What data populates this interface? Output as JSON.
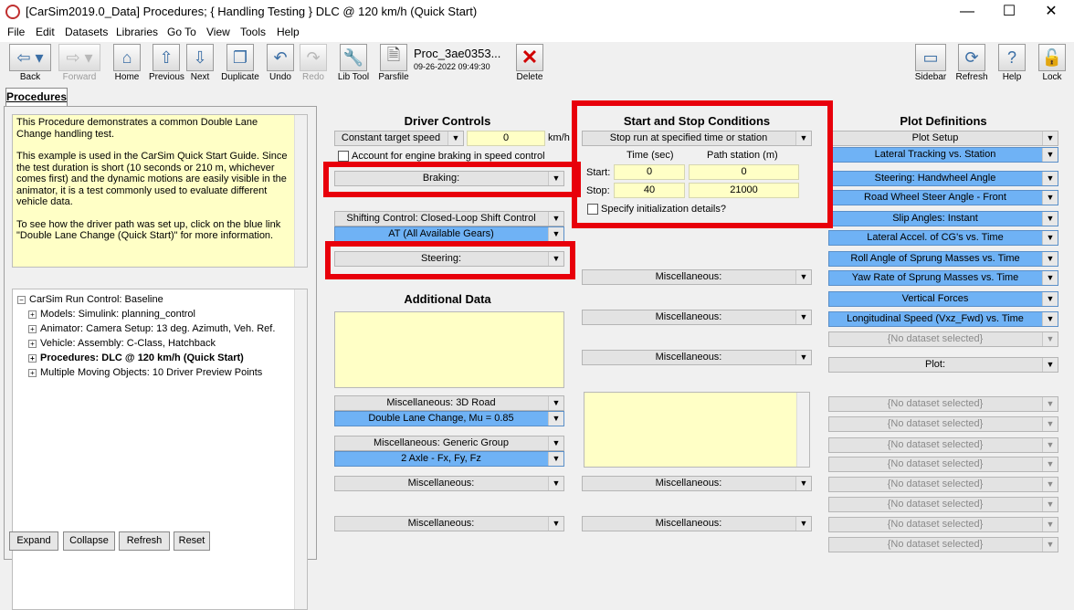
{
  "window": {
    "title": "[CarSim2019.0_Data] Procedures; { Handling Testing } DLC @ 120 km/h (Quick Start)",
    "minimize": "—",
    "maximize": "☐",
    "close": "✕"
  },
  "menu": [
    "File",
    "Edit",
    "Datasets",
    "Libraries",
    "Go To",
    "View",
    "Tools",
    "Help"
  ],
  "toolbar": {
    "back": "Back",
    "forward": "Forward",
    "home": "Home",
    "previous": "Previous",
    "next": "Next",
    "duplicate": "Duplicate",
    "undo": "Undo",
    "redo": "Redo",
    "lib_tool": "Lib Tool",
    "parsfile": "Parsfile",
    "dataset_name": "Proc_3ae0353...",
    "dataset_date": "09-26-2022 09:49:30",
    "delete": "Delete",
    "sidebar": "Sidebar",
    "refresh": "Refresh",
    "help": "Help",
    "lock": "Lock"
  },
  "tab": "Procedures",
  "notes": [
    "This Procedure demonstrates a common Double Lane Change handling test.",
    "This example is used in the CarSim Quick Start Guide. Since the test duration is short (10 seconds or 210 m, whichever comes first) and the dynamic motions are easily visible in the animator, it is a test commonly used to evaluate different vehicle data.",
    "To see how the driver path was set up, click on the blue link \"Double Lane Change (Quick Start)\" for more information."
  ],
  "tree": [
    "CarSim Run Control: Baseline",
    "Models: Simulink: planning_control",
    "Animator: Camera Setup: 13 deg. Azimuth, Veh. Ref.",
    "Vehicle: Assembly: C-Class, Hatchback",
    "Procedures: DLC @ 120 km/h (Quick Start)",
    "Multiple Moving Objects: 10 Driver Preview Points"
  ],
  "buttons": {
    "expand": "Expand",
    "collapse": "Collapse",
    "refresh": "Refresh",
    "reset": "Reset"
  },
  "driver": {
    "title": "Driver Controls",
    "speed_mode": "Constant target speed",
    "speed_value": "0",
    "speed_unit": "km/h",
    "engine_braking": "Account for engine braking in speed control",
    "braking": "Braking:",
    "shifting": "Shifting Control: Closed-Loop Shift Control",
    "gears": "AT (All Available Gears)",
    "steering": "Steering:"
  },
  "additional": {
    "title": "Additional Data",
    "misc_3d": "Miscellaneous: 3D Road",
    "road": "Double Lane Change, Mu = 0.85",
    "misc_generic": "Miscellaneous: Generic Group",
    "generic": "2 Axle - Fx, Fy, Fz",
    "misc1": "Miscellaneous:",
    "misc2": "Miscellaneous:"
  },
  "startstop": {
    "title": "Start and Stop Conditions",
    "mode": "Stop run at specified time or station",
    "time_header": "Time (sec)",
    "station_header": "Path station (m)",
    "start_label": "Start:",
    "stop_label": "Stop:",
    "start_time": "0",
    "start_station": "0",
    "stop_time": "40",
    "stop_station": "21000",
    "init_details": "Specify initialization details?",
    "misc": [
      "Miscellaneous:",
      "Miscellaneous:",
      "Miscellaneous:",
      "Miscellaneous:",
      "Miscellaneous:"
    ]
  },
  "plots": {
    "title": "Plot Definitions",
    "items": [
      {
        "label": "Plot Setup",
        "kind": "gray"
      },
      {
        "label": "Lateral Tracking vs. Station",
        "kind": "blue"
      },
      {
        "label": "Steering: Handwheel Angle",
        "kind": "blue"
      },
      {
        "label": "Road Wheel Steer Angle - Front",
        "kind": "blue"
      },
      {
        "label": "Slip Angles: Instant",
        "kind": "blue"
      },
      {
        "label": "Lateral Accel. of CG's vs. Time",
        "kind": "blue"
      },
      {
        "label": "Roll Angle of Sprung Masses vs. Time",
        "kind": "blue"
      },
      {
        "label": "Yaw Rate of Sprung Masses vs. Time",
        "kind": "blue"
      },
      {
        "label": "Vertical Forces",
        "kind": "blue"
      },
      {
        "label": "Longitudinal Speed (Vxz_Fwd) vs. Time",
        "kind": "blue"
      },
      {
        "label": "{No dataset selected}",
        "kind": "empty"
      },
      {
        "label": "Plot:",
        "kind": "gray"
      },
      {
        "label": "{No dataset selected}",
        "kind": "empty"
      },
      {
        "label": "{No dataset selected}",
        "kind": "empty"
      },
      {
        "label": "{No dataset selected}",
        "kind": "empty"
      },
      {
        "label": "{No dataset selected}",
        "kind": "empty"
      },
      {
        "label": "{No dataset selected}",
        "kind": "empty"
      },
      {
        "label": "{No dataset selected}",
        "kind": "empty"
      },
      {
        "label": "{No dataset selected}",
        "kind": "empty"
      },
      {
        "label": "{No dataset selected}",
        "kind": "empty"
      }
    ]
  },
  "colors": {
    "highlight": "#e8000b",
    "link_blue": "#6fb2f5",
    "notes_yellow": "#ffffc6"
  }
}
